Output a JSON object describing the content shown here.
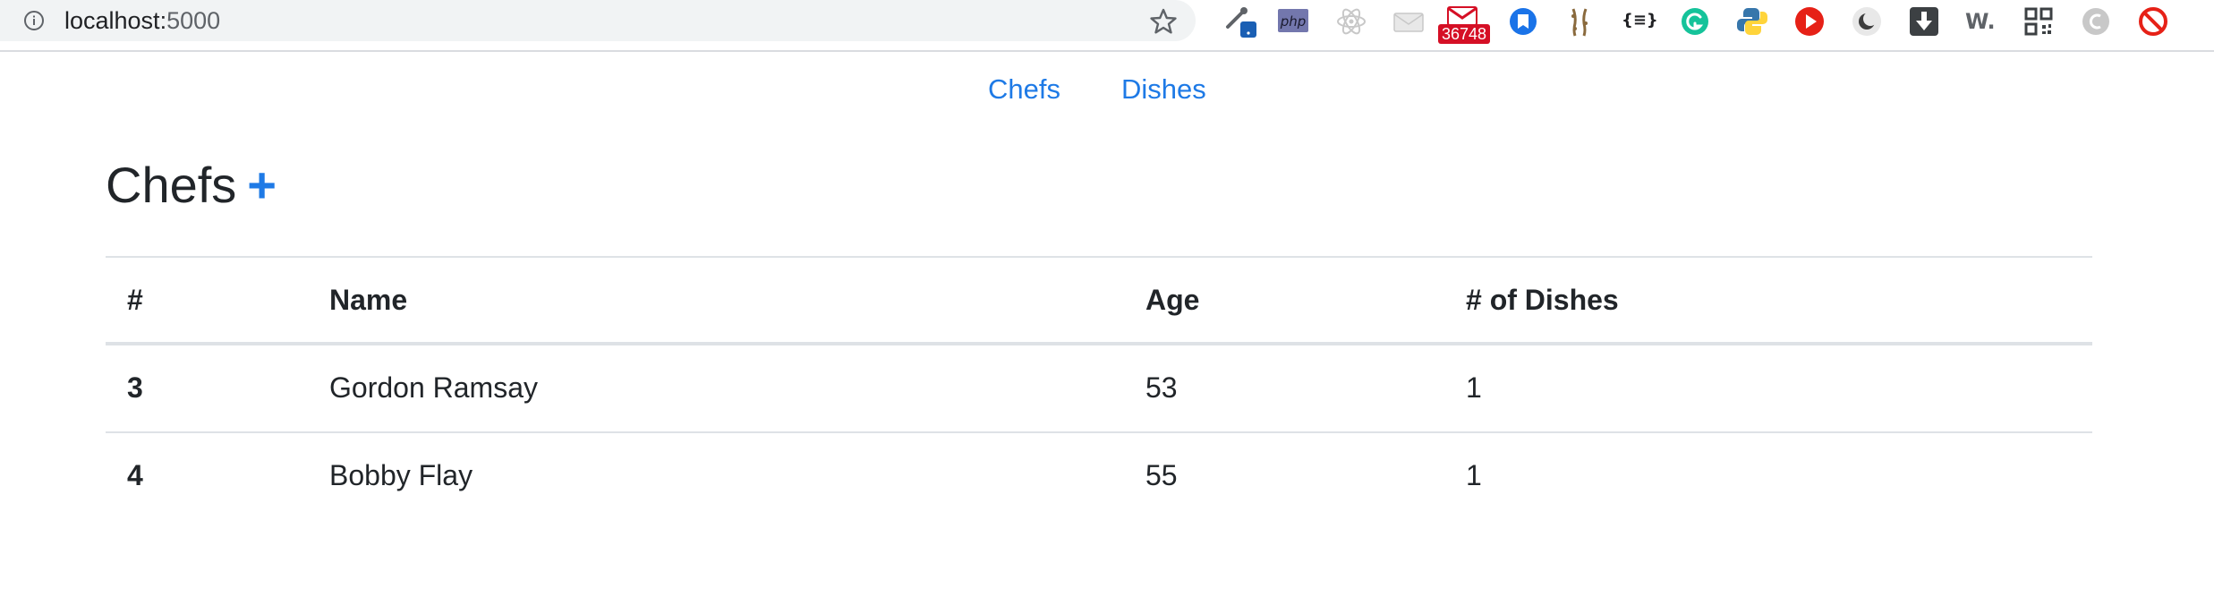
{
  "browser": {
    "url_host": "localhost:",
    "url_port": "5000",
    "extensions": [
      {
        "name": "eyedropper-extension-icon"
      },
      {
        "name": "php-extension-icon",
        "label": "php"
      },
      {
        "name": "react-devtools-icon"
      },
      {
        "name": "mail-extension-icon"
      },
      {
        "name": "gmail-checker-icon",
        "badge": "36748"
      },
      {
        "name": "bookmark-extension-icon"
      },
      {
        "name": "giraffe-extension-icon"
      },
      {
        "name": "json-formatter-icon",
        "label": "{≡}"
      },
      {
        "name": "grammarly-icon"
      },
      {
        "name": "python-extension-icon"
      },
      {
        "name": "youtube-extension-icon"
      },
      {
        "name": "dark-mode-icon"
      },
      {
        "name": "download-extension-icon"
      },
      {
        "name": "wappalyzer-icon",
        "label": "W."
      },
      {
        "name": "qr-code-icon"
      },
      {
        "name": "grey-circle-extension-icon"
      },
      {
        "name": "block-extension-icon"
      }
    ],
    "colors": {
      "gmail": "#d50f25",
      "grammarly": "#15c39a",
      "youtube": "#e62117",
      "bookmark": "#1a73e8",
      "php": "#7377ad"
    }
  },
  "nav": {
    "chefs_label": "Chefs",
    "dishes_label": "Dishes"
  },
  "page": {
    "title": "Chefs",
    "add_label": "+"
  },
  "table": {
    "headers": [
      "#",
      "Name",
      "Age",
      "# of Dishes"
    ],
    "rows": [
      {
        "id": "3",
        "name": "Gordon Ramsay",
        "age": "53",
        "dishes": "1"
      },
      {
        "id": "4",
        "name": "Bobby Flay",
        "age": "55",
        "dishes": "1"
      }
    ]
  },
  "colors": {
    "link": "#1e7ae6",
    "text": "#212529",
    "border": "#dee2e6"
  }
}
